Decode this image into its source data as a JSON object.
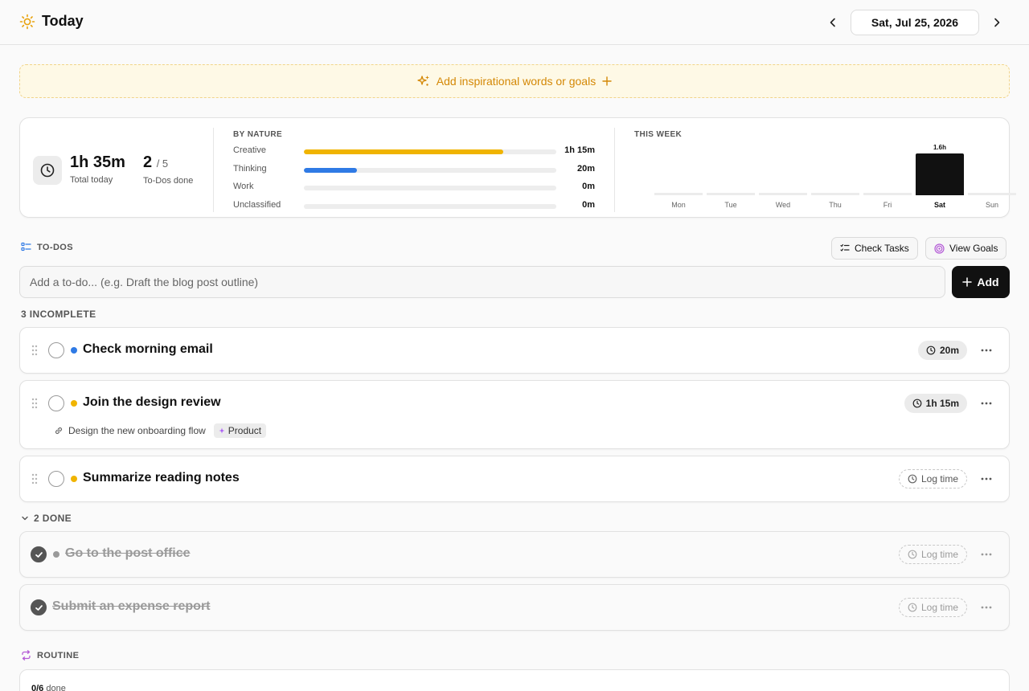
{
  "header": {
    "title": "Today",
    "date": "Sat, Jul 25, 2026"
  },
  "banner": {
    "label": "Add inspirational words or goals"
  },
  "stats": {
    "total_time": "1h 35m",
    "total_label": "Total today",
    "done_count": "2",
    "done_total": "/ 5",
    "done_label": "To-Dos done",
    "by_nature_title": "BY NATURE",
    "natures": [
      {
        "label": "Creative",
        "value": "1h 15m",
        "fraction": 0.79,
        "color": "#f0b400"
      },
      {
        "label": "Thinking",
        "value": "20m",
        "fraction": 0.21,
        "color": "#2f7ae5"
      },
      {
        "label": "Work",
        "value": "0m",
        "fraction": 0,
        "color": "#cccccc"
      },
      {
        "label": "Unclassified",
        "value": "0m",
        "fraction": 0,
        "color": "#cccccc"
      }
    ],
    "week_title": "THIS WEEK",
    "week": [
      {
        "day": "Mon",
        "hours": 0
      },
      {
        "day": "Tue",
        "hours": 0
      },
      {
        "day": "Wed",
        "hours": 0
      },
      {
        "day": "Thu",
        "hours": 0
      },
      {
        "day": "Fri",
        "hours": 0
      },
      {
        "day": "Sat",
        "hours": 1.6,
        "label": "1.6h",
        "active": true
      },
      {
        "day": "Sun",
        "hours": 0
      }
    ]
  },
  "todos": {
    "section_title": "TO-DOS",
    "check_tasks_label": "Check Tasks",
    "view_goals_label": "View Goals",
    "input_placeholder": "Add a to-do... (e.g. Draft the blog post outline)",
    "add_label": "Add",
    "incomplete_label": "3 INCOMPLETE",
    "done_label": "2 DONE",
    "incomplete": [
      {
        "title": "Check morning email",
        "dot": "#2f7ae5",
        "time": "20m"
      },
      {
        "title": "Join the design review",
        "dot": "#f0b400",
        "time": "1h 15m",
        "linked_goal": "Design the new onboarding flow",
        "tag": "Product"
      },
      {
        "title": "Summarize reading notes",
        "dot": "#f0b400",
        "log": "Log time"
      }
    ],
    "done": [
      {
        "title": "Go to the post office",
        "dot": "#9a9a9a",
        "log": "Log time"
      },
      {
        "title": "Submit an expense report",
        "log": "Log time"
      }
    ]
  },
  "routine": {
    "section_title": "ROUTINE",
    "done_count": "0/6",
    "done_label": "done"
  }
}
